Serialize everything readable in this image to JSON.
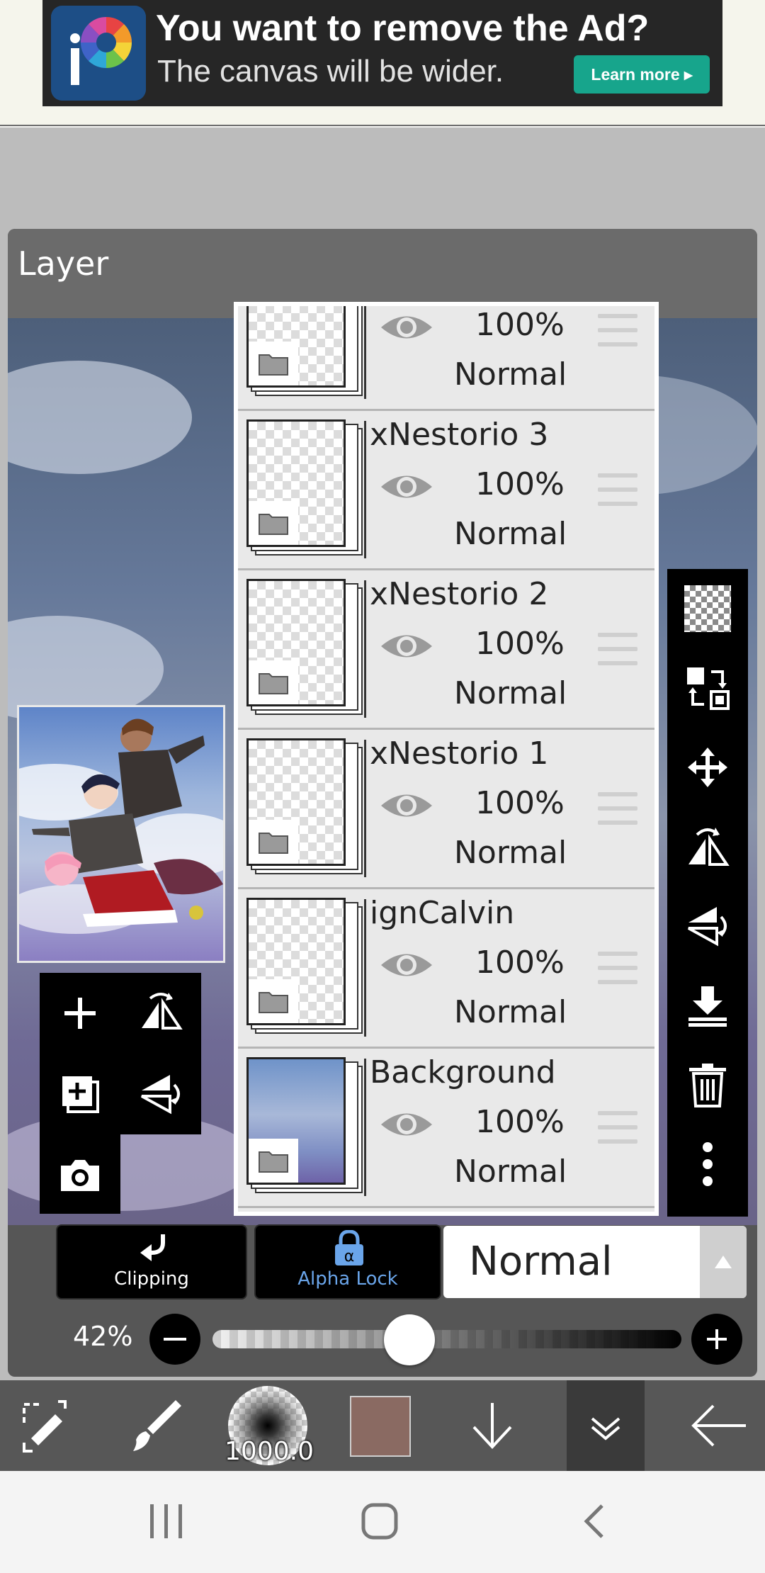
{
  "ad": {
    "title": "You want to remove the Ad?",
    "subtitle": "The canvas will be wider.",
    "button": "Learn more",
    "logo_icon": "ibis-paint-logo",
    "button_color": "#17a58c"
  },
  "layer_window": {
    "title": "Layer"
  },
  "layers": [
    {
      "name": "",
      "opacity": "100%",
      "mode": "Normal",
      "visible": true
    },
    {
      "name": "xNestorio 3",
      "opacity": "100%",
      "mode": "Normal",
      "visible": true
    },
    {
      "name": "xNestorio 2",
      "opacity": "100%",
      "mode": "Normal",
      "visible": true
    },
    {
      "name": "xNestorio 1",
      "opacity": "100%",
      "mode": "Normal",
      "visible": true
    },
    {
      "name": "ignCalvin",
      "opacity": "100%",
      "mode": "Normal",
      "visible": true
    },
    {
      "name": "Background",
      "opacity": "100%",
      "mode": "Normal",
      "visible": true
    }
  ],
  "left_tools": [
    "add-layer-icon",
    "flip-horizontal-icon",
    "duplicate-layer-icon",
    "flip-vertical-icon",
    "camera-icon"
  ],
  "right_tools": [
    "transparency-checker-icon",
    "swap-layer-icon",
    "move-icon",
    "flip-horizontal-icon",
    "flip-vertical-icon",
    "merge-down-icon",
    "trash-icon",
    "more-icon"
  ],
  "clipping": {
    "label": "Clipping"
  },
  "alpha_lock": {
    "label": "Alpha Lock",
    "color": "#6aa5ea"
  },
  "blend_mode": {
    "value": "Normal"
  },
  "opacity": {
    "label": "42%",
    "value": 0.42
  },
  "bottom_toolbar": {
    "brush_size": "1000.0",
    "color": "#8a6a62"
  }
}
